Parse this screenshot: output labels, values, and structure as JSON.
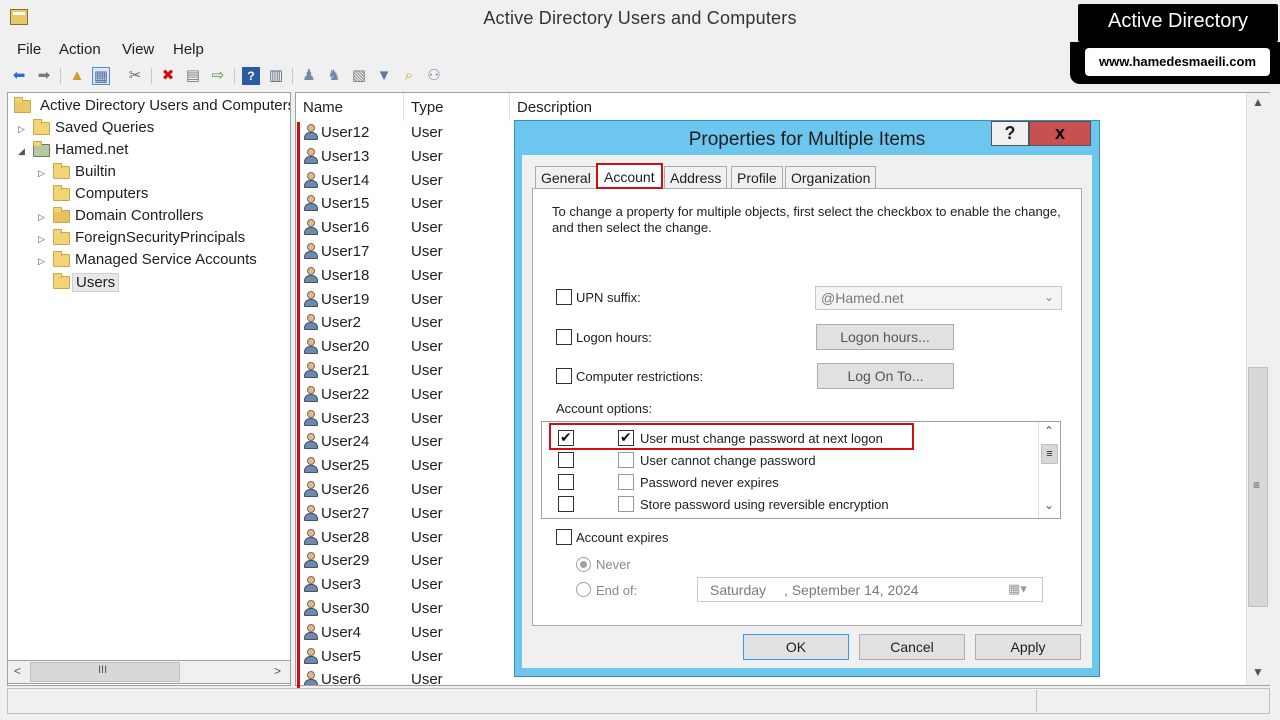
{
  "window": {
    "title": "Active Directory Users and Computers"
  },
  "watermark": {
    "title": "Active Directory",
    "site": "www.hamedesmaeili.com"
  },
  "menu": [
    "File",
    "Action",
    "View",
    "Help"
  ],
  "tree": {
    "root": "Active Directory Users and Computers",
    "saved_queries": "Saved Queries",
    "domain": "Hamed.net",
    "children": [
      "Builtin",
      "Computers",
      "Domain Controllers",
      "ForeignSecurityPrincipals",
      "Managed Service Accounts",
      "Users"
    ]
  },
  "list": {
    "columns": [
      "Name",
      "Type",
      "Description"
    ],
    "rows": [
      {
        "name": "User12",
        "type": "User"
      },
      {
        "name": "User13",
        "type": "User"
      },
      {
        "name": "User14",
        "type": "User"
      },
      {
        "name": "User15",
        "type": "User"
      },
      {
        "name": "User16",
        "type": "User"
      },
      {
        "name": "User17",
        "type": "User"
      },
      {
        "name": "User18",
        "type": "User"
      },
      {
        "name": "User19",
        "type": "User"
      },
      {
        "name": "User2",
        "type": "User"
      },
      {
        "name": "User20",
        "type": "User"
      },
      {
        "name": "User21",
        "type": "User"
      },
      {
        "name": "User22",
        "type": "User"
      },
      {
        "name": "User23",
        "type": "User"
      },
      {
        "name": "User24",
        "type": "User"
      },
      {
        "name": "User25",
        "type": "User"
      },
      {
        "name": "User26",
        "type": "User"
      },
      {
        "name": "User27",
        "type": "User"
      },
      {
        "name": "User28",
        "type": "User"
      },
      {
        "name": "User29",
        "type": "User"
      },
      {
        "name": "User3",
        "type": "User"
      },
      {
        "name": "User30",
        "type": "User"
      },
      {
        "name": "User4",
        "type": "User"
      },
      {
        "name": "User5",
        "type": "User"
      },
      {
        "name": "User6",
        "type": "User"
      }
    ]
  },
  "dialog": {
    "title": "Properties for Multiple Items",
    "help": "?",
    "close": "x",
    "tabs": [
      "General",
      "Account",
      "Address",
      "Profile",
      "Organization"
    ],
    "intro": "To change a property for multiple objects, first select the checkbox to enable the change, and then select the change.",
    "upn_label": "UPN suffix:",
    "upn_value": "@Hamed.net",
    "logon_hours_label": "Logon hours:",
    "logon_hours_button": "Logon hours...",
    "computer_restrictions_label": "Computer restrictions:",
    "logon_to_button": "Log On To...",
    "account_options_label": "Account options:",
    "options": [
      {
        "label": "User must change password at next logon",
        "enabled": true,
        "checked": true
      },
      {
        "label": "User cannot change password",
        "enabled": false,
        "checked": false
      },
      {
        "label": "Password never expires",
        "enabled": false,
        "checked": false
      },
      {
        "label": "Store password using reversible encryption",
        "enabled": false,
        "checked": false
      }
    ],
    "account_expires_label": "Account expires",
    "never_label": "Never",
    "end_of_label": "End of:",
    "date_day": "Saturday",
    "date_rest": ", September 14, 2024",
    "ok": "OK",
    "cancel": "Cancel",
    "apply": "Apply"
  },
  "colors": {
    "dialog_frame": "#6cc6ee",
    "highlight_red": "#d01010",
    "close_button": "#c75050"
  }
}
